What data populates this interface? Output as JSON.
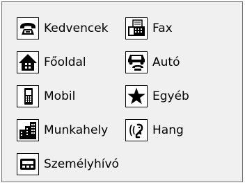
{
  "phone_types": [
    {
      "label": "Kedvencek",
      "icon": "telephone-icon"
    },
    {
      "label": "Főoldal",
      "icon": "home-icon"
    },
    {
      "label": "Mobil",
      "icon": "mobile-phone-icon"
    },
    {
      "label": "Munkahely",
      "icon": "office-building-icon"
    },
    {
      "label": "Személyhívó",
      "icon": "pager-icon"
    },
    {
      "label": "Fax",
      "icon": "fax-icon"
    },
    {
      "label": "Autó",
      "icon": "car-phone-icon"
    },
    {
      "label": "Egyéb",
      "icon": "star-icon"
    },
    {
      "label": "Hang",
      "icon": "voice-icon"
    }
  ]
}
